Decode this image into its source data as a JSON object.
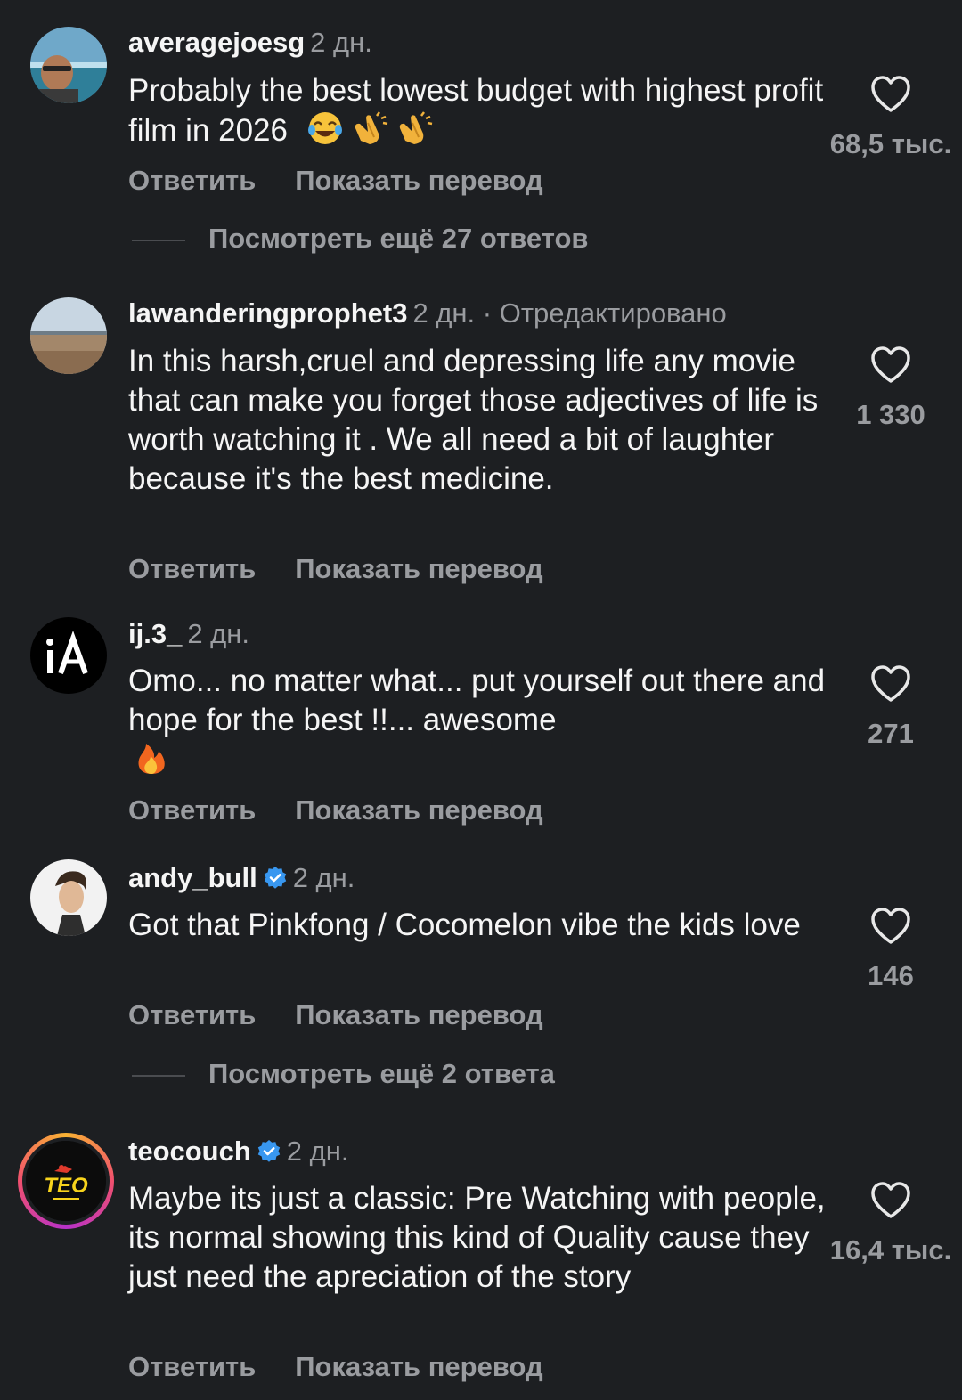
{
  "labels": {
    "reply": "Ответить",
    "show_translation": "Показать перевод"
  },
  "comments": [
    {
      "username": "averagejoesg",
      "meta": "2 дн.",
      "text": "Probably the best lowest budget with highest profit film in 2026",
      "emojis": [
        "joy-emoji",
        "clapping-hands-emoji",
        "clapping-hands-emoji"
      ],
      "likes": "68,5 тыс.",
      "view_more": "Посмотреть ещё 27 ответов"
    },
    {
      "username": "lawanderingprophet3",
      "meta": "2 дн. · Отредактировано",
      "text": "In this harsh,cruel and depressing life any movie that can make you forget those adjectives of life is worth watching it .  We all need a bit of laughter because it's the best medicine.",
      "likes": "1 330"
    },
    {
      "username": "ij.3_",
      "meta": "2 дн.",
      "text": "Omo... no matter what... put yourself out there and hope for the best !!... awesome",
      "emojis": [
        "fire-emoji"
      ],
      "likes": "271"
    },
    {
      "username": "andy_bull",
      "verified": true,
      "meta": "2 дн.",
      "text": "Got that Pinkfong / Cocomelon vibe the kids love",
      "likes": "146",
      "view_more": "Посмотреть ещё 2 ответа"
    },
    {
      "username": "teocouch",
      "verified": true,
      "meta": "2 дн.",
      "text": "Maybe its just a classic: Pre Watching with people, its normal showing this kind of Quality cause they just need the apreciation of the story",
      "likes": "16,4 тыс.",
      "avatar_text": "TEO"
    }
  ],
  "colors": {
    "background": "#1d1f22",
    "text_primary": "#f5f5f5",
    "text_secondary": "#9a9ca0",
    "verified": "#3897f0"
  }
}
